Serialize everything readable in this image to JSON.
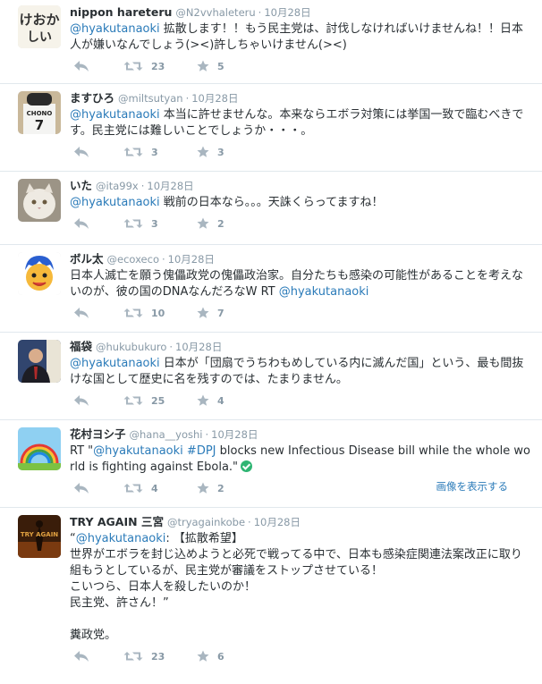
{
  "tweets": [
    {
      "name": "nippon hareteru",
      "handle": "@N2vvhaleteru",
      "time": "10月28日",
      "avatar_text": "けおか しい",
      "mention": "@hyakutanaoki",
      "body": " 拡散します！！もう民主党は、討伐しなければいけませんね！！日本人が嫌いなんでしょう(><)許しちゃいけません(><)",
      "retweets": "23",
      "favorites": "5"
    },
    {
      "name": "ますひろ",
      "handle": "@miltsutyan",
      "time": "10月28日",
      "avatar_text": "CHONO 7",
      "mention": "@hyakutanaoki",
      "body": " 本当に許せませんな。本来ならエボラ対策には挙国一致で臨むべきです。民主党には難しいことでしょうか・・・。",
      "retweets": "3",
      "favorites": "3"
    },
    {
      "name": "いた",
      "handle": "@ita99x",
      "time": "10月28日",
      "mention": "@hyakutanaoki",
      "body": " 戦前の日本なら。。。天誅くらってますね！",
      "retweets": "3",
      "favorites": "2"
    },
    {
      "name": "ボル太",
      "handle": "@ecoxeco",
      "time": "10月28日",
      "body": "日本人滅亡を願う傀儡政党の傀儡政治家。自分たちも感染の可能性があることを考えないのが、彼の国のDNAなんだろなW RT ",
      "mention_end": "@hyakutanaoki",
      "retweets": "10",
      "favorites": "7"
    },
    {
      "name": "福袋",
      "handle": "@hukubukuro",
      "time": "10月28日",
      "mention": "@hyakutanaoki",
      "body": " 日本が「団扇でうちわもめしている内に滅んだ国」という、最も間抜けな国として歴史に名を残すのでは、たまりません。",
      "retweets": "25",
      "favorites": "4"
    },
    {
      "name": "花村ヨシ子",
      "handle": "@hana__yoshi",
      "time": "10月28日",
      "prefix": "RT \"",
      "mention": "@hyakutanaoki",
      "hashtag": "#DPJ",
      "body": " blocks new Infectious Disease bill while the whole world is fighting against Ebola.\"",
      "retweets": "4",
      "favorites": "2",
      "media_link": "画像を表示する"
    },
    {
      "name": "TRY AGAIN 三宮",
      "handle": "@tryagainkobe",
      "time": "10月28日",
      "avatar_text": "TRY AGAIN",
      "prefix": "“",
      "mention": "@hyakutanaoki",
      "body": ": 【拡散希望】\n世界がエボラを封じ込めようと必死で戦ってる中で、日本も感染症関連法案改正に取り組もうとしているが、民主党が審議をストップさせている！\nこいつら、日本人を殺したいのか！\n民主党、許さん！”\n\n糞政党。",
      "retweets": "23",
      "favorites": "6"
    }
  ],
  "colors": {
    "link": "#2b7bb9",
    "meta": "#8899a6",
    "text": "#292f33",
    "border": "#e1e8ed"
  },
  "icons": [
    "reply-icon",
    "retweet-icon",
    "favorite-icon",
    "verified-check-icon"
  ]
}
